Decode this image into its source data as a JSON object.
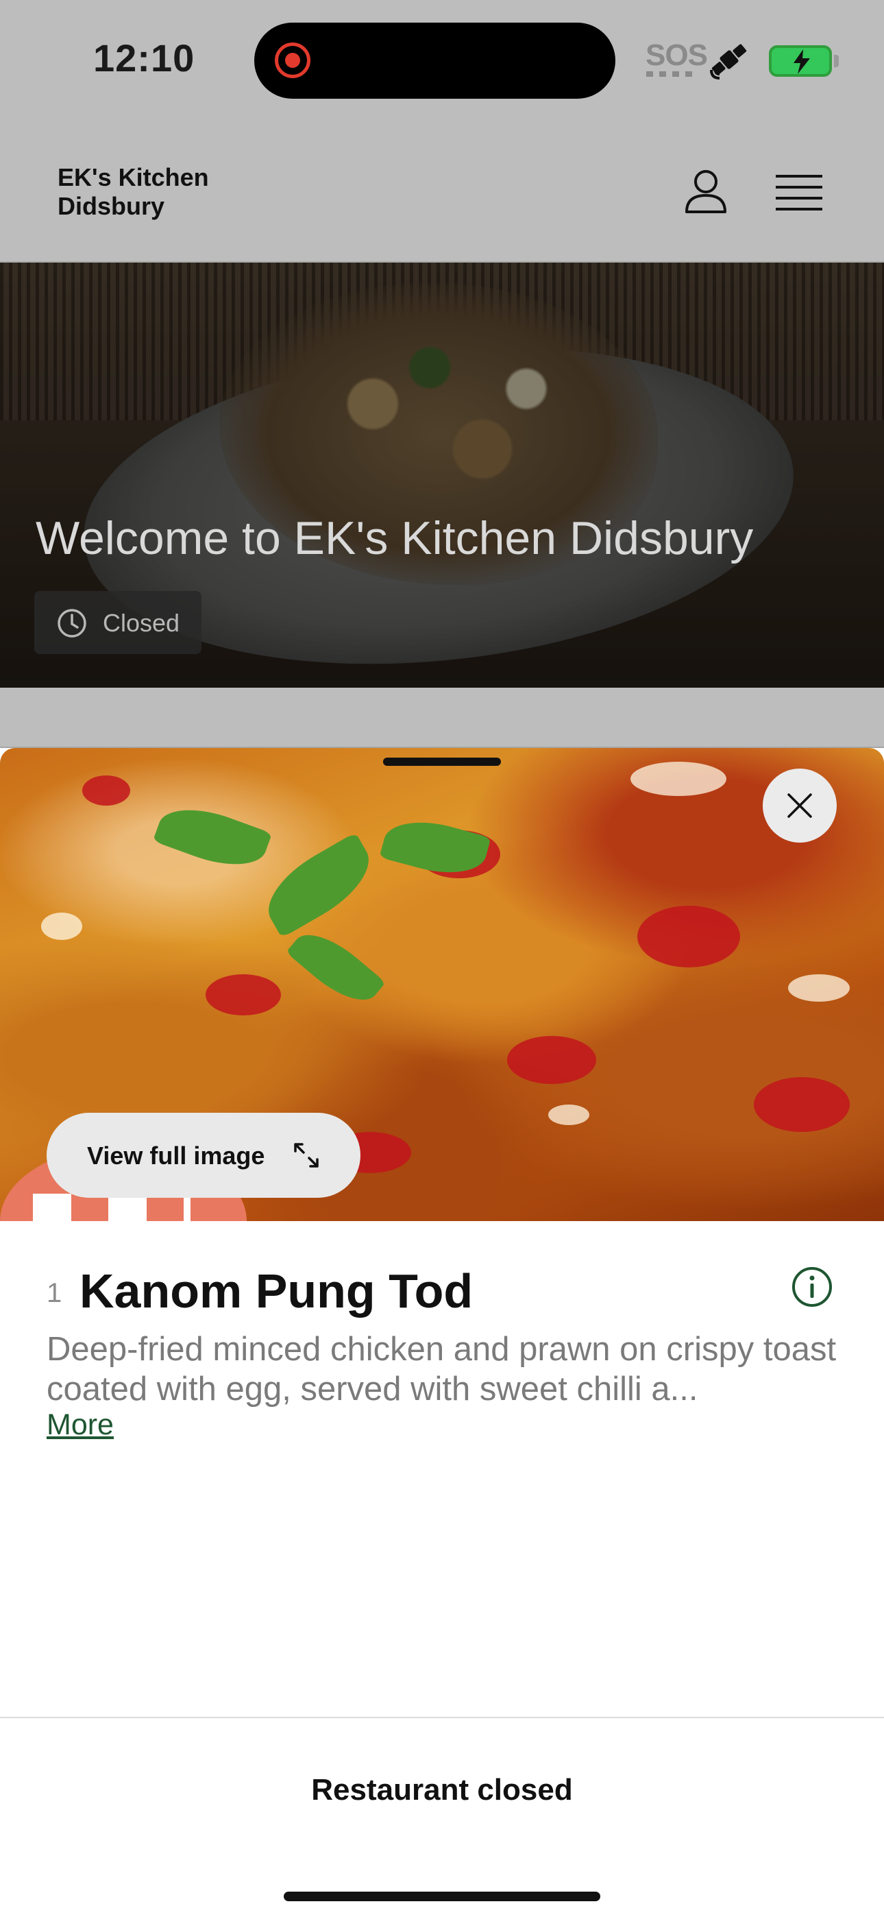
{
  "status_bar": {
    "time": "12:10",
    "sos": "SOS",
    "battery_color": "#34c759",
    "recording_color": "#e23a2c"
  },
  "header": {
    "restaurant_name": "EK's Kitchen Didsbury",
    "icons": [
      "user-icon",
      "hamburger-menu-icon"
    ]
  },
  "hero": {
    "title": "Welcome to EK's Kitchen Didsbury",
    "status": "Closed",
    "status_icon": "clock-icon"
  },
  "dish_sheet": {
    "view_image_label": "View full image",
    "number": "1",
    "name": "Kanom Pung Tod",
    "description": "Deep-fried minced chicken and prawn on crispy toast coated with egg, served with sweet chilli a...",
    "more_label": "More",
    "icons": [
      "close-icon",
      "expand-icon",
      "info-icon"
    ]
  },
  "footer": {
    "closed_label": "Restaurant closed"
  },
  "colors": {
    "accent_green": "#1e5631",
    "overlay_gray": "#bdbdbd"
  }
}
